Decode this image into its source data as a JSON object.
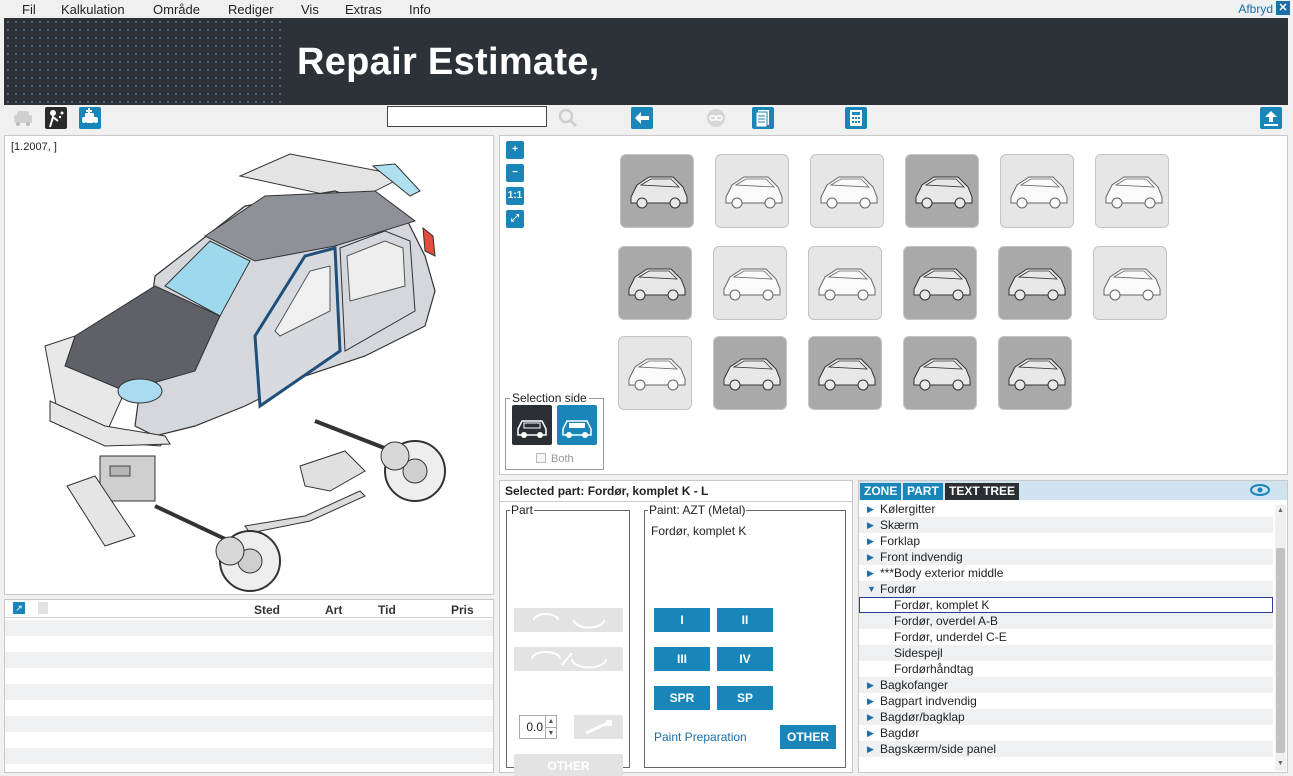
{
  "menu": {
    "items": [
      "Fil",
      "Kalkulation",
      "Område",
      "Rediger",
      "Vis",
      "Extras",
      "Info"
    ],
    "cancel_label": "Afbryd"
  },
  "banner": {
    "title": "Repair Estimate"
  },
  "toolbar": {
    "search_value": "",
    "icons": [
      "vehicle-icon",
      "paint-person-icon",
      "vehicle-add-icon",
      "search-icon",
      "back-arrow-icon",
      "link-icon",
      "document-icon",
      "calculator-icon",
      "upload-icon"
    ]
  },
  "vehicle": {
    "code": "[1.2007, ]"
  },
  "views": {
    "zoom_buttons": [
      "zoom-in-icon",
      "zoom-out-icon",
      "1:1",
      "fit-icon"
    ],
    "selection_side_title": "Selection side",
    "both_label": "Both",
    "thumbnails": [
      [
        "dark",
        "light",
        "light",
        "dark",
        "light",
        "light"
      ],
      [
        "dark",
        "light",
        "light",
        "dark",
        "dark",
        "light"
      ],
      [
        "light",
        "dark",
        "dark",
        "dark",
        "dark"
      ]
    ]
  },
  "list": {
    "columns": [
      "Sted",
      "Art",
      "Tid",
      "Pris"
    ],
    "rows": []
  },
  "part": {
    "selected_label": "Selected part: Fordør, komplet K - L",
    "part_group_title": "Part",
    "paint_group_title": "Paint: AZT (Metal)",
    "paint_part_name": "Fordør, komplet K",
    "quantity": "0.0",
    "other_disabled_label": "OTHER",
    "paint_buttons": [
      "I",
      "II",
      "III",
      "IV",
      "SPR",
      "SP"
    ],
    "paint_preparation_label": "Paint Preparation",
    "other_label": "OTHER"
  },
  "tree": {
    "tabs": [
      "ZONE",
      "PART",
      "TEXT TREE"
    ],
    "items": [
      {
        "label": "Kølergitter",
        "level": 0,
        "state": "collapsed"
      },
      {
        "label": "Skærm",
        "level": 0,
        "state": "collapsed"
      },
      {
        "label": "Forklap",
        "level": 0,
        "state": "collapsed"
      },
      {
        "label": "Front indvendig",
        "level": 0,
        "state": "collapsed"
      },
      {
        "label": "***Body exterior middle",
        "level": 0,
        "state": "collapsed"
      },
      {
        "label": "Fordør",
        "level": 0,
        "state": "expanded"
      },
      {
        "label": "Fordør, komplet K",
        "level": 1,
        "state": "selected"
      },
      {
        "label": "Fordør, overdel A-B",
        "level": 1,
        "state": "leaf"
      },
      {
        "label": "Fordør, underdel C-E",
        "level": 1,
        "state": "leaf"
      },
      {
        "label": "Sidespejl",
        "level": 1,
        "state": "leaf"
      },
      {
        "label": "Fordørhåndtag",
        "level": 1,
        "state": "leaf"
      },
      {
        "label": "Bagkofanger",
        "level": 0,
        "state": "collapsed"
      },
      {
        "label": "Bagpart indvendig",
        "level": 0,
        "state": "collapsed"
      },
      {
        "label": "Bagdør/bagklap",
        "level": 0,
        "state": "collapsed"
      },
      {
        "label": "Bagdør",
        "level": 0,
        "state": "collapsed"
      },
      {
        "label": "Bagskærm/side panel",
        "level": 0,
        "state": "collapsed"
      }
    ]
  },
  "colors": {
    "accent": "#1a85b9",
    "banner": "#2d3138",
    "selection_outline": "#2b3a9c"
  }
}
